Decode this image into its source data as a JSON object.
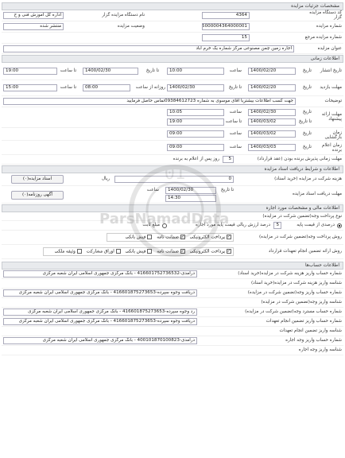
{
  "sections": {
    "details": "مشخصات جزئیات مزایده",
    "time": "اطلاعات زمانی",
    "conditions": "اطلاعات و شرایط دریافت اسناد مزایده",
    "property": "اطلاعات مالی و مشخصات مورد اجاره",
    "accounts": "اطلاعات حساب‌ها"
  },
  "details": {
    "auction_code_label": "کد دستگاه مزایده گزار",
    "auction_code": "4364",
    "org_name_label": "نام دستگاه مزایده گزار",
    "org_name": "اداره کل آموزش فنی و ح",
    "auction_number_label": "شماره مزایده",
    "auction_number": "5000004364000001",
    "status_label": "وضعیت مزایده",
    "status": "منتشر شده",
    "ref_number_label": "شماره مزایده مرجع",
    "ref_number": "15",
    "title_label": "عنوان مزایده",
    "title": "اجاره زمین چمن مصنوعی مرکز شماره یک خرم آباد"
  },
  "time": {
    "publish_label": "تاریخ انتشار",
    "date_label": "تاریخ",
    "to_date_label": "تا تاریخ",
    "hour_label": "ساعت",
    "to_hour_label": "تا ساعت",
    "day_label": "روزانه از ساعت",
    "publish_date": "1400/02/20",
    "publish_hour": "10:00",
    "publish_to_date": "1400/02/30",
    "publish_to_hour": "19:00",
    "visit_label": "مهلت بازدید",
    "visit_date": "1400/02/20",
    "visit_from_hour": "08:00",
    "visit_to_date": "1400/02/30",
    "visit_to_hour": "15:00",
    "desc_label": "توضیحات",
    "desc": "جهت کسب اطلاعات بیشتربا آقای موسوی به شماره 09384612723تماس حاصل فرمایید",
    "offer_label": "مهلت ارائه پیشنهاد",
    "offer_date": "1400/02/30",
    "offer_hour": "10:05",
    "offer_to_date": "1400/03/02",
    "offer_to_hour": "19:00",
    "open_label": "زمان بازگشایی",
    "open_date": "1400/03/02",
    "open_hour": "09:00",
    "announce_label": "زمان اعلام برنده",
    "announce_date": "1400/03/03",
    "announce_hour": "09:00"
  },
  "contract": {
    "label": "مهلت زمانی پذیرش برنده بودن (عقد قرارداد)",
    "value": "5",
    "suffix": "روز پس از اعلام به برنده"
  },
  "conditions": {
    "fee_label": "هزینه شرکت در مزایده (خرید اسناد)",
    "fee_value": "0",
    "fee_unit": "ریال",
    "docs_button": "اسناد مزایده(۰)",
    "deadline_label": "مهلت دریافت اسناد مزایده",
    "deadline_date_label": "تا تاریخ",
    "deadline_date": "1400/02/30",
    "deadline_hour_label": "ساعت",
    "deadline_hour": "14:30",
    "ad_button": "آگهی روزنامه(۰)"
  },
  "property": {
    "payment_label": "نوع پرداخت وجه(تضمین شرکت در مزایده)",
    "percent_label": "درصدی از قیمت پایه",
    "percent_value": "5",
    "percent_suffix": "درصد ارزش ریالی قیمت پایه مورد اجاره",
    "fixed_label": "مبلغ ثابت",
    "method_label": "روش پرداخت وجه(تضمین شرکت در مزایده)",
    "method_options": [
      "پرداخت الکترونیکی",
      "ضمانت نامه",
      "فیش بانکی"
    ],
    "guarantee_label": "روش ارائه تضمین انجام تعهدات قرارداد",
    "guarantee_options": [
      "پرداخت الکترونیکی",
      "ضمانت نامه",
      "فیش بانکی",
      "اوراق مشارکت",
      "وثیقه ملکی"
    ]
  },
  "accounts": {
    "rows": [
      {
        "label": "شماره حساب واریز هزینه شرکت در مزایده(خرید اسناد)",
        "value": "درآمدی-416601752736532 - بانک مرکزی جمهوری اسلامی ایران شعبه مرکزی"
      },
      {
        "label": "شناسه واریز هزینه شرکت در مزایده(خرید اسناد)",
        "value": ""
      },
      {
        "label": "شماره حساب واریز وجه(تضمین شرکت در مزایده)",
        "value": "دریافت وجوه سپرده-416601875273653 - بانک مرکزی جمهوری اسلامی ایران شعبه مرکزی"
      },
      {
        "label": "شناسه واریز وجه(تضمین شرکت در مزایده)",
        "value": ""
      },
      {
        "label": "شماره حساب مسترد وجه(تضمین شرکت در مزایده)",
        "value": "رد وجوه سپرده-416601875273653 - بانک مرکزی جمهوری اسلامی ایران شعبه مرکزی"
      },
      {
        "label": "شماره حساب واریز تضمین انجام تعهدات",
        "value": "دریافت وجوه سپرده-416601875273653 - بانک مرکزی جمهوری اسلامی ایران شعبه مرکزی"
      },
      {
        "label": "شناسه واریز تضمین انجام تعهدات",
        "value": ""
      },
      {
        "label": "شماره حساب واریز وجه اجاره",
        "value": "درآمدی-400101870100823 - بانک مرکزی جمهوری اسلامی ایران شعبه مرکزی"
      },
      {
        "label": "شناسه واریز وجه اجاره",
        "value": ""
      }
    ]
  },
  "watermark": {
    "text": "ParsNamadData"
  }
}
